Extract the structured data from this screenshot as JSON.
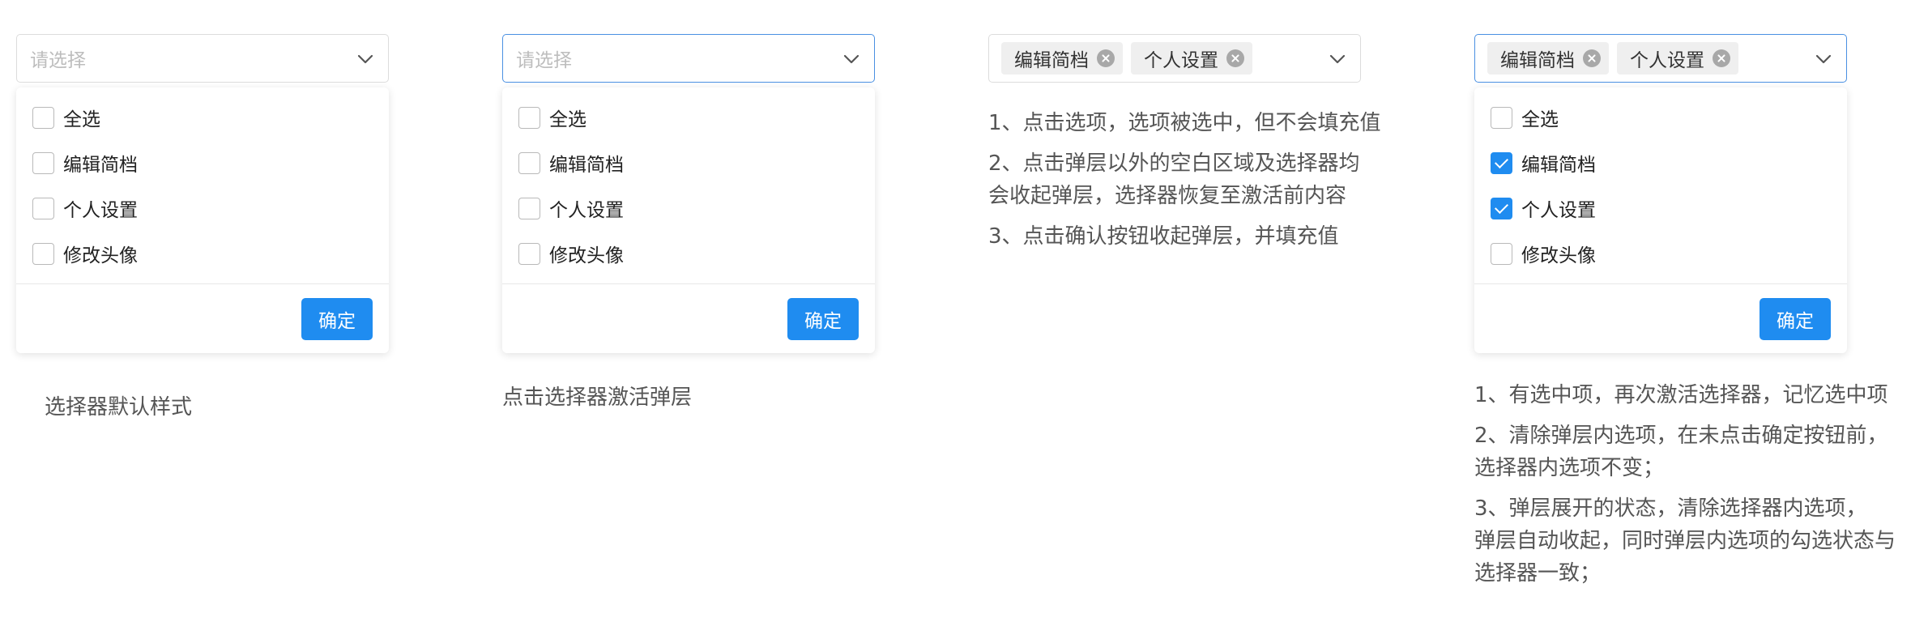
{
  "placeholder": "请选择",
  "options": [
    "全选",
    "编辑简档",
    "个人设置",
    "修改头像"
  ],
  "confirm_label": "确定",
  "tags": [
    "编辑简档",
    "个人设置"
  ],
  "captions": {
    "panel1": "选择器默认样式",
    "panel2": "点击选择器激活弹层"
  },
  "notes_panel3": [
    "1、点击选项，选项被选中，但不会填充值",
    "2、点击弹层以外的空白区域及选择器均",
    "会收起弹层，选择器恢复至激活前内容",
    "3、点击确认按钮收起弹层，并填充值"
  ],
  "notes_panel4": [
    "1、有选中项，再次激活选择器，记忆选中项",
    "2、清除弹层内选项，在未点击确定按钮前，",
    "选择器内选项不变；",
    "3、弹层展开的状态，清除选择器内选项，",
    "弹层自动收起，同时弹层内选项的勾选状态与",
    "选择器一致；"
  ],
  "colors": {
    "primary": "#1f8cf0",
    "active_border": "#4a90e2",
    "default_border": "#dcdcdc",
    "tag_bg": "#efefef",
    "caption": "#555555"
  },
  "icons": {
    "chevron": "chevron-down-icon",
    "tag_close": "circle-x-icon",
    "check": "checkmark-icon"
  },
  "panel4_checked": [
    false,
    true,
    true,
    false
  ]
}
